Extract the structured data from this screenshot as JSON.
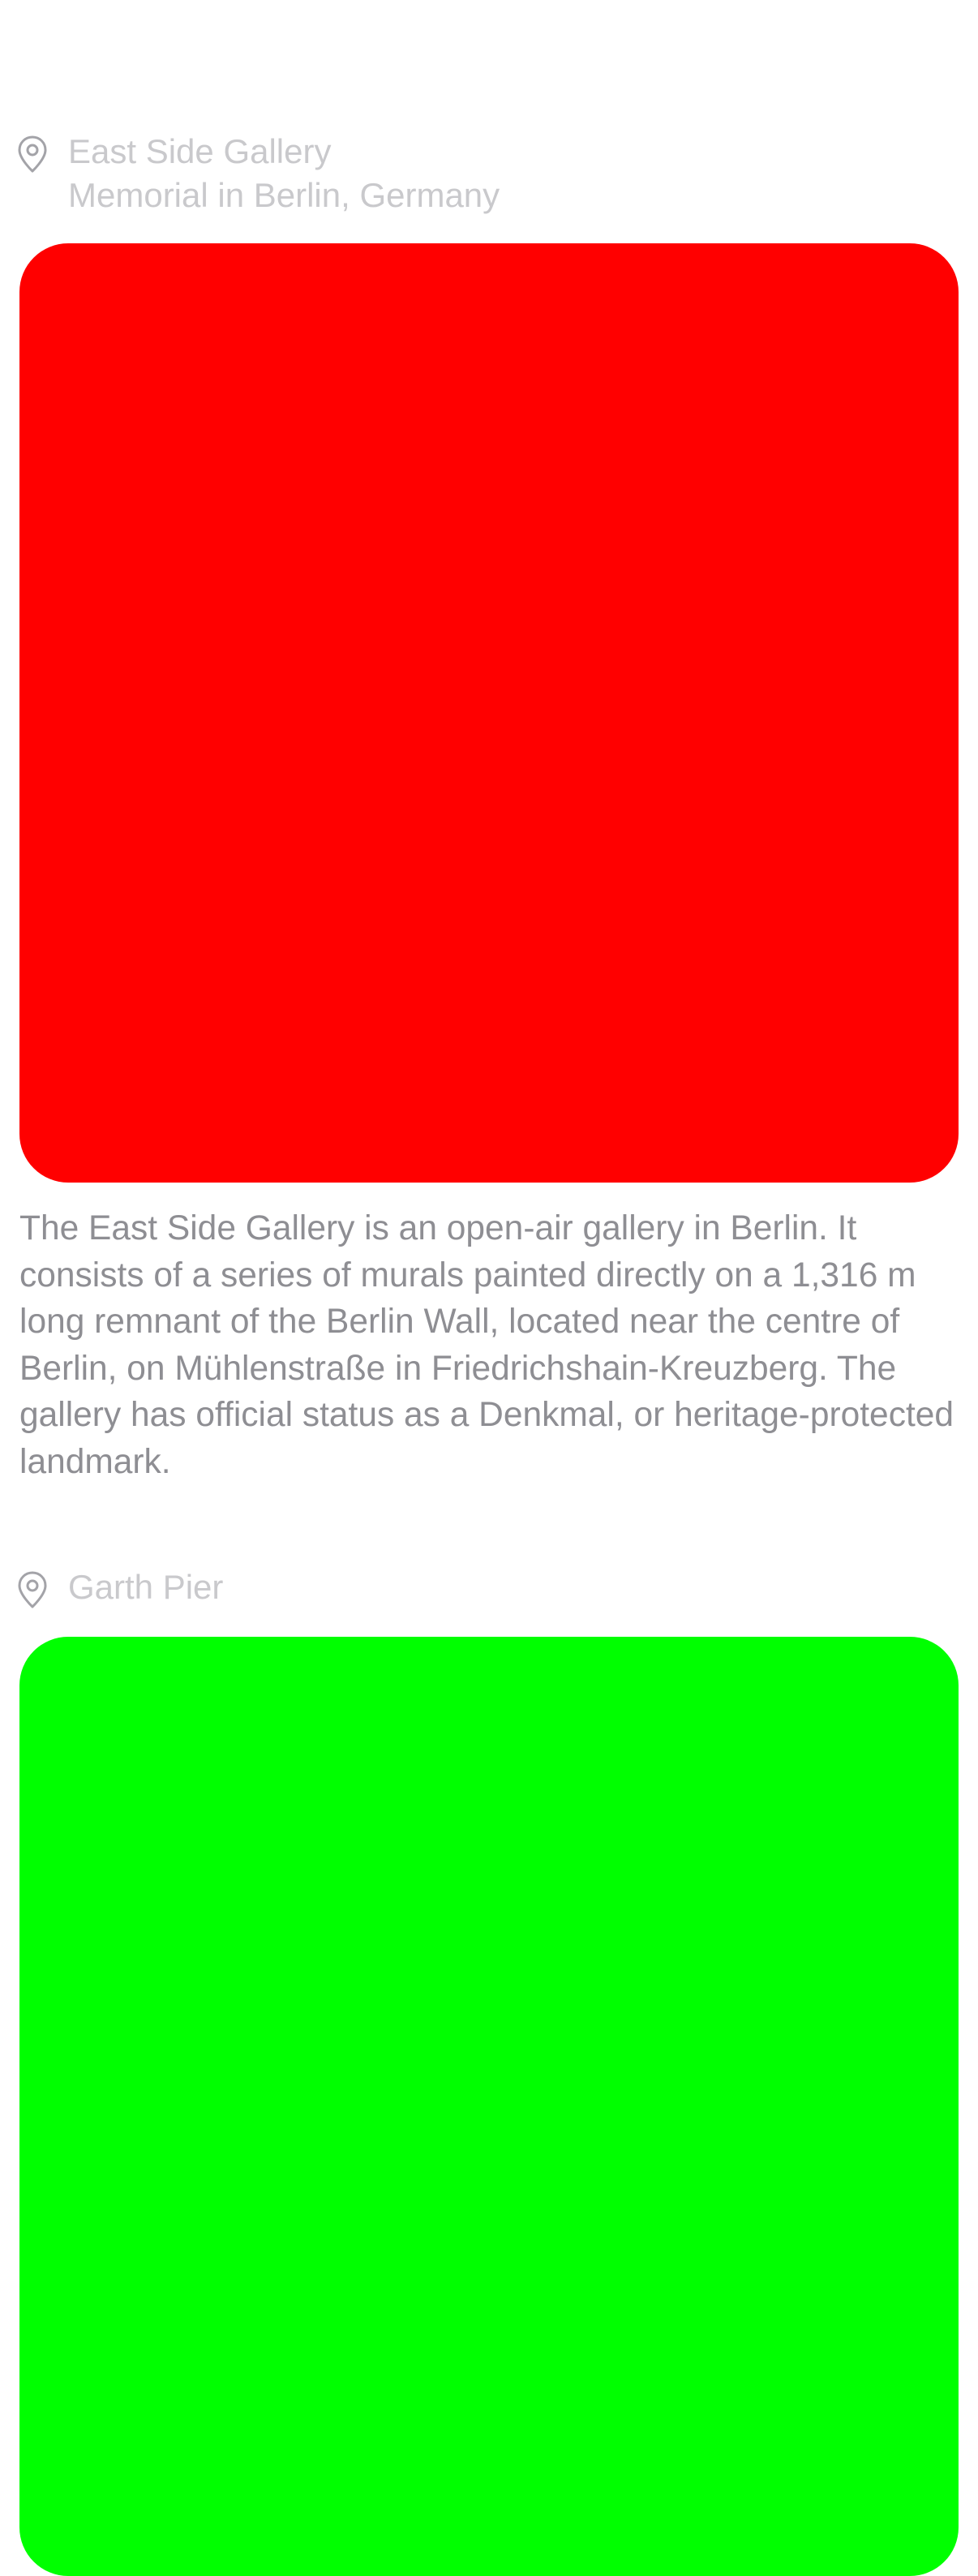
{
  "posts": [
    {
      "location": {
        "title": "East Side Gallery",
        "subtitle": "Memorial in Berlin, Germany",
        "icon": "location-pin-icon"
      },
      "photo_color": "#ff0000",
      "description": "The East Side Gallery is an open-air gallery in Berlin. It consists of a series of murals painted directly on a 1,316 m long remnant of the Berlin Wall, located near the centre of Berlin, on Mühlenstraße in Friedrichshain-Kreuzberg. The gallery has official status as a Denkmal, or heritage-protected landmark."
    },
    {
      "location": {
        "title": "Garth Pier",
        "icon": "location-pin-icon"
      },
      "photo_color": "#00ff00"
    }
  ],
  "colors": {
    "location_text": "#c9c9cc",
    "description_text": "#8e8e93",
    "background": "#ffffff"
  }
}
